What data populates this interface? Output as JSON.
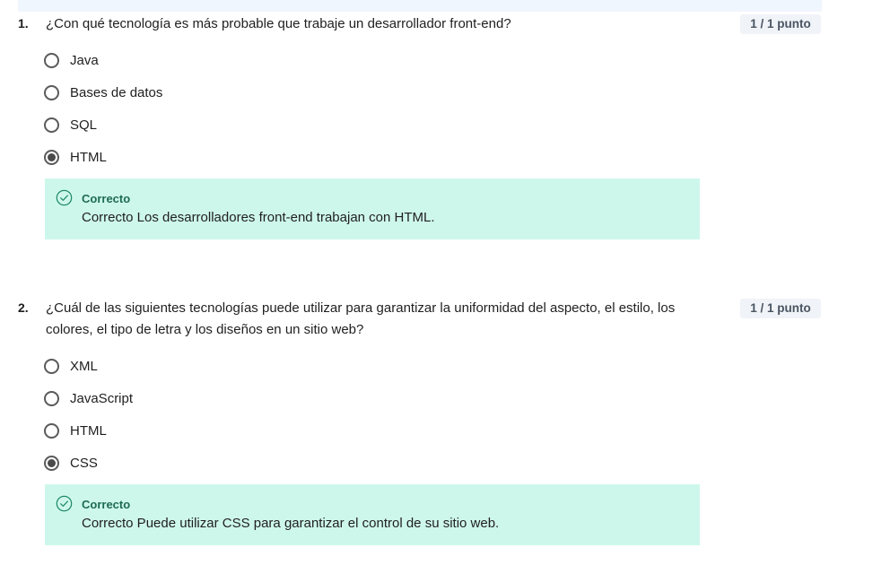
{
  "questions": [
    {
      "number": "1.",
      "text": "¿Con qué tecnología es más probable que trabaje un desarrollador front-end?",
      "points": "1 / 1 punto",
      "options": [
        {
          "label": "Java",
          "selected": false
        },
        {
          "label": "Bases de datos",
          "selected": false
        },
        {
          "label": "SQL",
          "selected": false
        },
        {
          "label": "HTML",
          "selected": true
        }
      ],
      "feedback": {
        "title": "Correcto",
        "text": "Correcto Los desarrolladores front-end trabajan con HTML."
      }
    },
    {
      "number": "2.",
      "text": "¿Cuál de las siguientes tecnologías puede utilizar para garantizar la uniformidad del aspecto, el estilo, los colores, el tipo de letra y los diseños en un sitio web?",
      "points": "1 / 1 punto",
      "options": [
        {
          "label": "XML",
          "selected": false
        },
        {
          "label": "JavaScript",
          "selected": false
        },
        {
          "label": "HTML",
          "selected": false
        },
        {
          "label": "CSS",
          "selected": true
        }
      ],
      "feedback": {
        "title": "Correcto",
        "text": "Correcto Puede utilizar CSS para garantizar el control de su sitio web."
      }
    }
  ],
  "colors": {
    "feedback_background": "#cef7ec",
    "feedback_title": "#1d6b52",
    "check_icon": "#1d8a63",
    "points_badge_background": "#f0f3f7"
  },
  "icons": {
    "feedback": "check-circle-icon"
  }
}
